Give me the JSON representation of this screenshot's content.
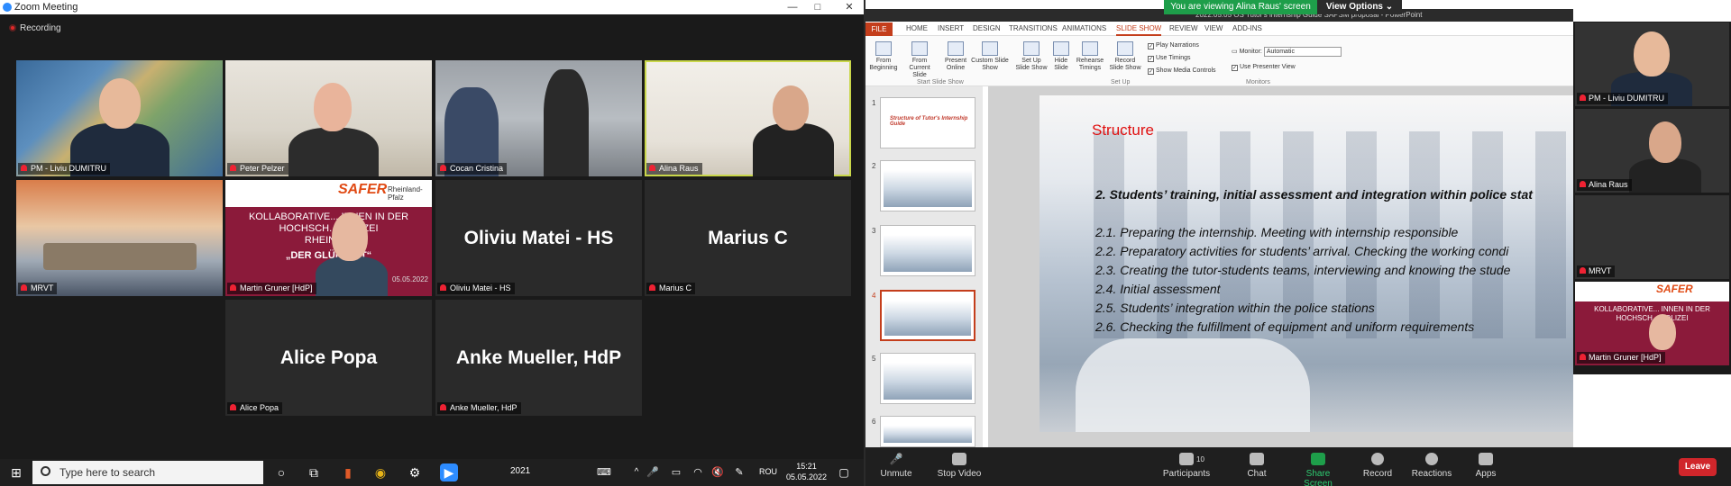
{
  "left_window": {
    "title": "Zoom Meeting",
    "recording": "Recording",
    "window_controls": [
      "—",
      "□",
      "✕"
    ]
  },
  "participants": [
    {
      "name": "PM - Liviu DUMITRU",
      "video": true,
      "active": false
    },
    {
      "name": "Peter Pelzer",
      "video": true,
      "active": false
    },
    {
      "name": "Cocan Cristina",
      "video": true,
      "active": false
    },
    {
      "name": "Alina Raus",
      "video": true,
      "active": true
    },
    {
      "name": "MRVT",
      "video": true,
      "active": false
    },
    {
      "name": "Martin Gruner [HdP]",
      "video": true,
      "active": false
    },
    {
      "name": "Oliviu Matei - HS",
      "video": false,
      "active": false
    },
    {
      "name": "Marius C",
      "video": false,
      "active": false
    },
    {
      "name": "Alice Popa",
      "video": false,
      "active": false
    },
    {
      "name": "Anke Mueller, HdP",
      "video": false,
      "active": false
    }
  ],
  "martin_slide": {
    "brand": "SAFER",
    "partner": "Rheinland-Pfalz",
    "line1": "KOLLABORATIVE... INNEN IN DER",
    "line2": "HOCHSCH... POLIZEI",
    "line3": "RHEIN... Z",
    "quote": "„DER GLÜH... KT“",
    "date": "05.05.2022"
  },
  "taskbar": {
    "search_placeholder": "Type here to search",
    "year_label": "2021",
    "language": "ROU",
    "time": "15:21",
    "date": "05.05.2022"
  },
  "share": {
    "banner": "You are viewing Alina Raus' screen",
    "view_options": "View Options"
  },
  "powerpoint": {
    "title": "2022.05.05 OS Tutor's internship Guide SAPSM proposal - PowerPoint",
    "tabs": [
      "FILE",
      "HOME",
      "INSERT",
      "DESIGN",
      "TRANSITIONS",
      "ANIMATIONS",
      "SLIDE SHOW",
      "REVIEW",
      "VIEW",
      "ADD-INS"
    ],
    "active_tab": "SLIDE SHOW",
    "buttons": [
      {
        "label": "From Beginning"
      },
      {
        "label": "From Current Slide"
      },
      {
        "label": "Present Online"
      },
      {
        "label": "Custom Slide Show"
      },
      {
        "label": "Set Up Slide Show"
      },
      {
        "label": "Hide Slide"
      },
      {
        "label": "Rehearse Timings"
      },
      {
        "label": "Record Slide Show"
      }
    ],
    "checks": [
      "Play Narrations",
      "Use Timings",
      "Show Media Controls"
    ],
    "monitor_label": "Monitor:",
    "monitor_value": "Automatic",
    "presenter_view": "Use Presenter View",
    "groups": [
      "Start Slide Show",
      "Set Up",
      "Monitors"
    ],
    "thumb_numbers": [
      "1",
      "2",
      "3",
      "4",
      "5",
      "6"
    ],
    "selected_thumb": 4,
    "thumb1_title": "Structure of Tutor's Internship Guide",
    "slide": {
      "title": "Structure",
      "heading": "2. Students’ training, initial assessment and integration within police stat",
      "items": [
        "2.1. Preparing the internship. Meeting with internship responsible",
        "2.2. Preparatory activities for students’ arrival. Checking the working condi",
        "2.3. Creating the tutor-students teams, interviewing and knowing the stude",
        "2.4. Initial assessment",
        "2.5. Students’ integration within the police stations",
        "2.6. Checking the fulfillment of equipment and uniform requirements"
      ]
    }
  },
  "gallery": [
    {
      "name": "PM - Liviu DUMITRU"
    },
    {
      "name": "Alina Raus"
    },
    {
      "name": "MRVT"
    },
    {
      "name": "Martin Gruner [HdP]"
    }
  ],
  "toolbar": {
    "unmute": "Unmute",
    "stop_video": "Stop Video",
    "participants": "Participants",
    "participants_count": "10",
    "chat": "Chat",
    "share_screen": "Share Screen",
    "record": "Record",
    "reactions": "Reactions",
    "apps": "Apps",
    "leave": "Leave"
  },
  "colors": {
    "ppt_accent": "#c43e1c",
    "share_green": "#1e9e4a",
    "leave_red": "#d0262b",
    "active_speaker": "#c9d74a"
  }
}
